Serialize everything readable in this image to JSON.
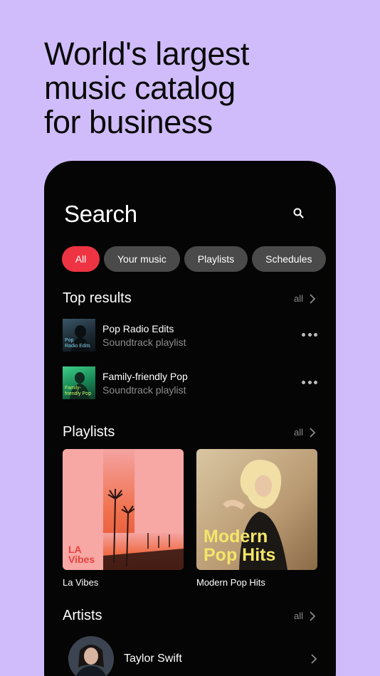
{
  "headline": [
    "World's largest",
    "music catalog",
    "for business"
  ],
  "screen": {
    "title": "Search",
    "search_icon": "search-icon",
    "chips": [
      {
        "label": "All",
        "active": true
      },
      {
        "label": "Your music",
        "active": false
      },
      {
        "label": "Playlists",
        "active": false
      },
      {
        "label": "Schedules",
        "active": false
      }
    ],
    "top_results": {
      "title": "Top results",
      "all_label": "all",
      "items": [
        {
          "title": "Pop Radio Edits",
          "subtitle": "Soundtrack playlist",
          "thumb_text": "Pop\nRadio Edits"
        },
        {
          "title": "Family-friendly Pop",
          "subtitle": "Soundtrack playlist",
          "thumb_text": "Family-\nfriendly Pop"
        }
      ]
    },
    "playlists": {
      "title": "Playlists",
      "all_label": "all",
      "items": [
        {
          "label": "La Vibes",
          "cover_text": "LA\nVibes"
        },
        {
          "label": "Modern Pop Hits",
          "cover_text": "Modern\nPop Hits"
        }
      ]
    },
    "artists": {
      "title": "Artists",
      "all_label": "all",
      "items": [
        {
          "name": "Taylor Swift"
        }
      ]
    }
  },
  "colors": {
    "background": "#d0bcfb",
    "phone": "#050505",
    "accent": "#ee3442",
    "chip": "#4a4a4a"
  }
}
